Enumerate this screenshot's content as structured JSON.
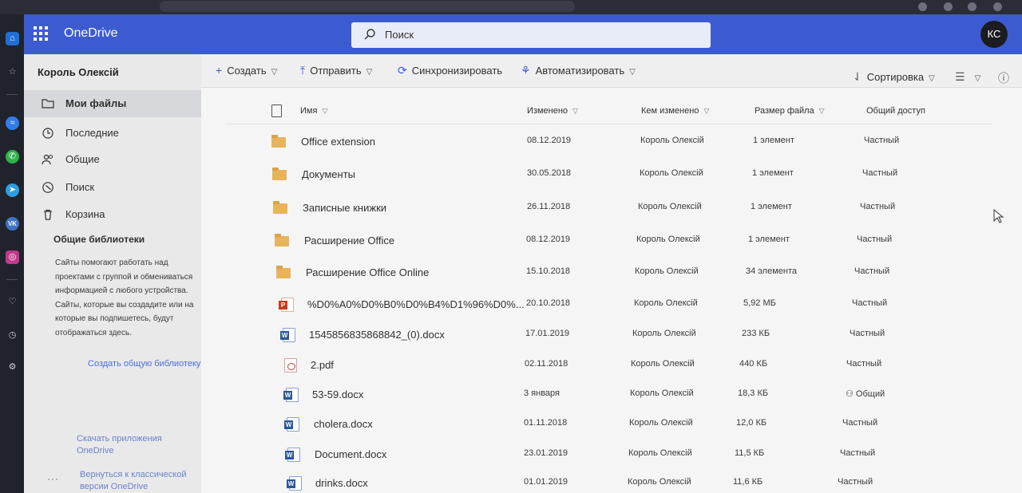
{
  "header": {
    "app_name": "OneDrive",
    "search_placeholder": "Поиск",
    "account_initials": "КС"
  },
  "nav": {
    "user_name": "Король Олексій",
    "items": [
      {
        "label": "Мои файлы",
        "icon": "folder-icon",
        "active": true
      },
      {
        "label": "Последние",
        "icon": "clock-icon",
        "active": false
      },
      {
        "label": "Общие",
        "icon": "people-icon",
        "active": false
      },
      {
        "label": "Поиск",
        "icon": "compass-icon",
        "active": false
      },
      {
        "label": "Корзина",
        "icon": "trash-icon",
        "active": false
      }
    ],
    "shared_libraries_title": "Общие библиотеки",
    "shared_libraries_desc": "Сайты помогают работать над проектами с группой и обмениваться информацией с любого устройства. Сайты, которые вы создадите или на которые вы подпишетесь, будут отображаться здесь.",
    "create_shared_library": "Создать общую библиотеку",
    "get_apps": "Скачать приложения OneDrive",
    "classic_view": "Вернуться к классической версии OneDrive",
    "more": "···"
  },
  "commands": {
    "create": "Создать",
    "upload": "Отправить",
    "sync": "Синхронизировать",
    "automate": "Автоматизировать",
    "sort": "Сортировка"
  },
  "columns": {
    "name": "Имя",
    "modified": "Изменено",
    "modified_by": "Кем изменено",
    "size": "Размер файла",
    "sharing": "Общий доступ"
  },
  "files": [
    {
      "type": "folder",
      "name": "Office extension",
      "modified": "08.12.2019",
      "modified_by": "Король Олексій",
      "size": "1 элемент",
      "sharing": "Частный"
    },
    {
      "type": "folder",
      "name": "Документы",
      "modified": "30.05.2018",
      "modified_by": "Король Олексій",
      "size": "1 элемент",
      "sharing": "Частный"
    },
    {
      "type": "folder",
      "name": "Записные книжки",
      "modified": "26.11.2018",
      "modified_by": "Король Олексій",
      "size": "1 элемент",
      "sharing": "Частный"
    },
    {
      "type": "folder",
      "name": "Расширение Office",
      "modified": "08.12.2019",
      "modified_by": "Король Олексій",
      "size": "1 элемент",
      "sharing": "Частный"
    },
    {
      "type": "folder",
      "name": "Расширение Office Online",
      "modified": "15.10.2018",
      "modified_by": "Король Олексій",
      "size": "34 элемента",
      "sharing": "Частный"
    },
    {
      "type": "ppt",
      "name": "%D0%A0%D0%B0%D0%B4%D1%96%D0%...",
      "modified": "20.10.2018",
      "modified_by": "Король Олексій",
      "size": "5,92 МБ",
      "sharing": "Частный"
    },
    {
      "type": "word",
      "name": "1545856835868842_(0).docx",
      "modified": "17.01.2019",
      "modified_by": "Король Олексій",
      "size": "233 КБ",
      "sharing": "Частный"
    },
    {
      "type": "pdf",
      "name": "2.pdf",
      "modified": "02.11.2018",
      "modified_by": "Король Олексій",
      "size": "440 КБ",
      "sharing": "Частный"
    },
    {
      "type": "word",
      "name": "53-59.docx",
      "modified": "3 января",
      "modified_by": "Король Олексій",
      "size": "18,3 КБ",
      "sharing": "Общий"
    },
    {
      "type": "word",
      "name": "cholera.docx",
      "modified": "01.11.2018",
      "modified_by": "Король Олексій",
      "size": "12,0 КБ",
      "sharing": "Частный"
    },
    {
      "type": "word",
      "name": "Document.docx",
      "modified": "23.01.2019",
      "modified_by": "Король Олексій",
      "size": "11,5 КБ",
      "sharing": "Частный"
    },
    {
      "type": "word",
      "name": "drinks.docx",
      "modified": "01.01.2019",
      "modified_by": "Король Олексій",
      "size": "11,6 КБ",
      "sharing": "Частный"
    }
  ]
}
